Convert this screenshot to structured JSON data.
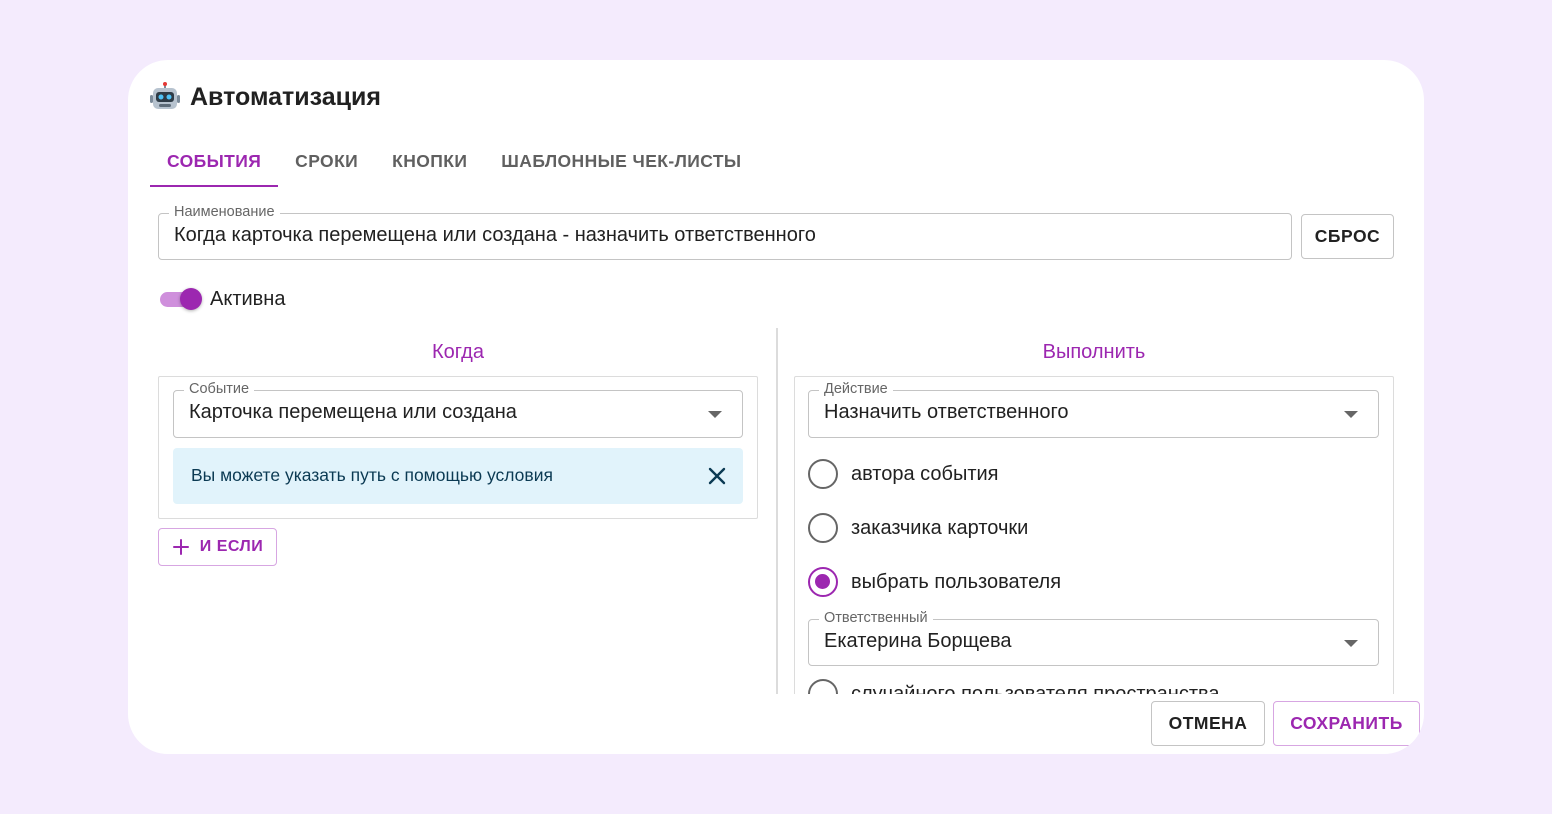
{
  "dialog": {
    "title": "Автоматизация",
    "icon": "robot-icon"
  },
  "tabs": [
    {
      "label": "События",
      "active": true
    },
    {
      "label": "Сроки",
      "active": false
    },
    {
      "label": "Кнопки",
      "active": false
    },
    {
      "label": "Шаблонные чек-листы",
      "active": false
    }
  ],
  "name_field": {
    "label": "Наименование",
    "value": "Когда карточка перемещена или создана  - назначить ответственного"
  },
  "reset_label": "Сброс",
  "active_toggle": {
    "label": "Активна",
    "on": true
  },
  "when": {
    "heading": "Когда",
    "event_field": {
      "label": "Событие",
      "value": "Карточка перемещена или создана"
    },
    "alert_text": "Вы можете указать путь с помощью условия",
    "and_if_label": "И если"
  },
  "execute": {
    "heading": "Выполнить",
    "action_field": {
      "label": "Действие",
      "value": "Назначить ответственного"
    },
    "options": [
      {
        "label": "автора события",
        "checked": false
      },
      {
        "label": "заказчика карточки",
        "checked": false
      },
      {
        "label": "выбрать пользователя",
        "checked": true
      },
      {
        "label": "случайного пользователя пространства",
        "checked": false
      }
    ],
    "responsible_field": {
      "label": "Ответственный",
      "value": "Екатерина Борщева"
    }
  },
  "footer": {
    "cancel_label": "Отмена",
    "save_label": "Сохранить"
  },
  "colors": {
    "accent": "#9c27b0",
    "page_background": "#f4ebfd",
    "alert_background": "#e1f3fb"
  }
}
